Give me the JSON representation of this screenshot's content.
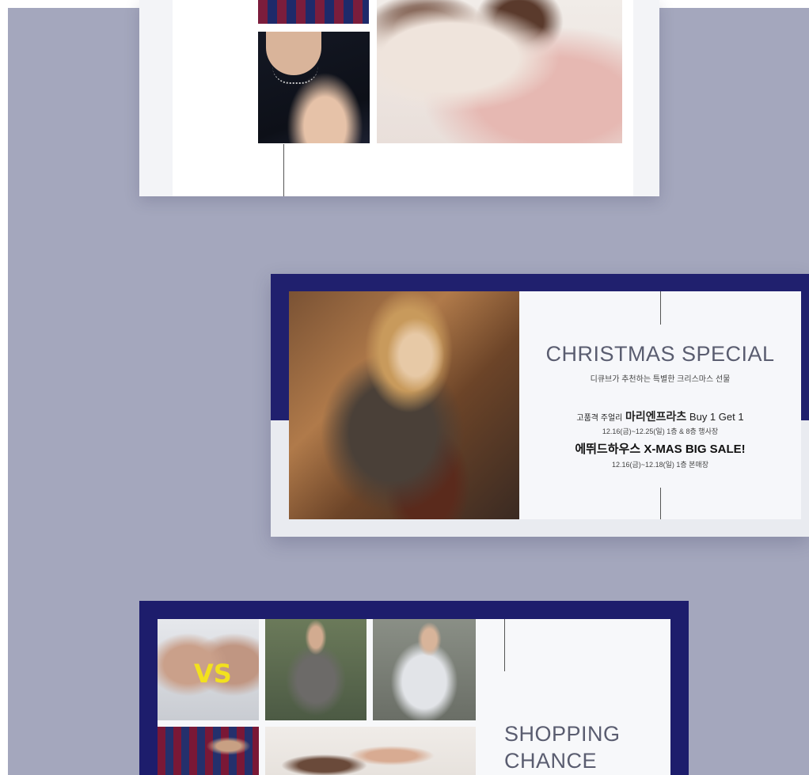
{
  "colors": {
    "background": "#a4a7bd",
    "navy_frame": "#20206e",
    "card_white": "#f6f7fa",
    "vs_yellow": "#f2e11e"
  },
  "card1": {
    "images": [
      "soccer-jersey-image",
      "necklace-model-image",
      "girls-dresses-image"
    ]
  },
  "card2": {
    "title": "CHRISTMAS SPECIAL",
    "subtitle": "디큐브가 추천하는 특별한 크리스마스 선물",
    "offer1": {
      "prefix": "고품격 주얼리",
      "brand": "마리엔프라츠",
      "promo": "Buy 1 Get 1"
    },
    "offer1_date": "12.16(금)~12.25(일) 1층 & 8층 행사장",
    "offer2": {
      "brand": "에뛰드하우스",
      "promo": "X-MAS BIG SALE!"
    },
    "offer2_date": "12.16(금)~12.18(일) 1층 본매장"
  },
  "card3": {
    "vs_label": "VS",
    "title_line1": "SHOPPING",
    "title_line2": "CHANCE"
  }
}
